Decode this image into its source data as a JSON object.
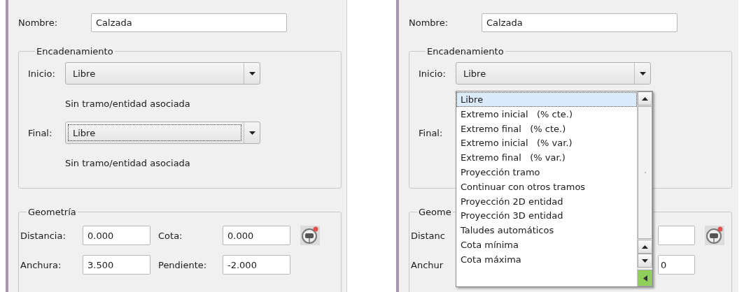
{
  "left_panel": {
    "name_label": "Nombre:",
    "name_value": "Calzada",
    "chaining": {
      "title": "Encadenamiento",
      "rows": [
        {
          "label": "Inicio:",
          "value": "Libre",
          "focused": false,
          "note": "Sin tramo/entidad asociada"
        },
        {
          "label": "Final:",
          "value": "Libre",
          "focused": true,
          "note": "Sin tramo/entidad asociada"
        }
      ]
    },
    "geometry": {
      "title": "Geometría",
      "rows": [
        {
          "label": "Distancia:",
          "value": "0.000",
          "label_2": "Cota:",
          "value_2": "0.000"
        },
        {
          "label": "Anchura:",
          "value": "3.500",
          "label_2": "Pendiente:",
          "value_2": "-2.000"
        }
      ]
    }
  },
  "right_panel": {
    "name_label": "Nombre:",
    "name_value": "Calzada",
    "chaining_title": "Encadenamiento",
    "start_label": "Inicio:",
    "start_value": "Libre",
    "end_label": "Final:",
    "geometry_title": "Geome",
    "geometry_rows": [
      {
        "label": "Distanc"
      },
      {
        "label": "Anchur",
        "field_tail": "0"
      }
    ],
    "dropdown": {
      "options": [
        {
          "label": "Libre",
          "selected": true
        },
        {
          "label": "Extremo inicial   (% cte.)",
          "selected": false
        },
        {
          "label": "Extremo final   (% cte.)",
          "selected": false
        },
        {
          "label": "Extremo inicial   (% var.)",
          "selected": false
        },
        {
          "label": "Extremo final   (% var.)",
          "selected": false
        },
        {
          "label": "Proyección tramo",
          "selected": false
        },
        {
          "label": "Continuar con otros tramos",
          "selected": false
        },
        {
          "label": "Proyección 2D entidad",
          "selected": false
        },
        {
          "label": "Proyección 3D entidad",
          "selected": false
        },
        {
          "label": "Taludes automáticos",
          "selected": false
        },
        {
          "label": "Cota mínima",
          "selected": false
        },
        {
          "label": "Cota máxima",
          "selected": false
        }
      ]
    }
  }
}
